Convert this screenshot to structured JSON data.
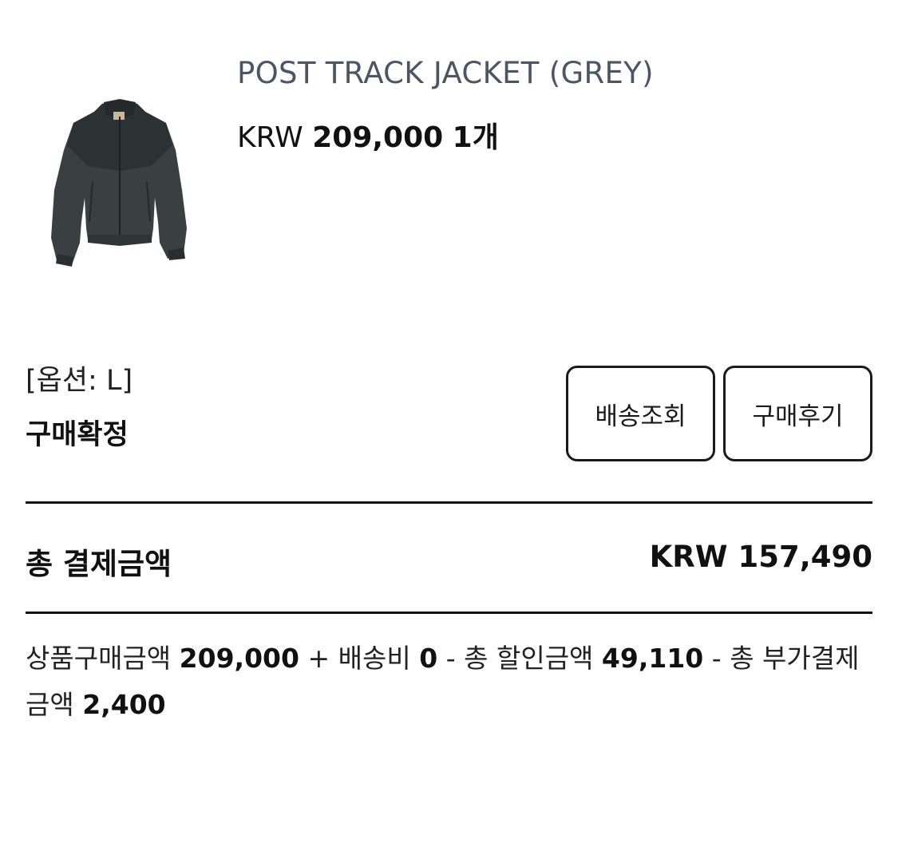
{
  "product": {
    "title": "POST TRACK JACKET (GREY)",
    "currency": "KRW",
    "price": "209,000",
    "quantity": "1개",
    "image_icon": "jacket-thumbnail"
  },
  "order": {
    "option": "[옵션: L]",
    "status": "구매확정"
  },
  "actions": {
    "shipping_label": "배송조회",
    "review_label": "구매후기"
  },
  "total": {
    "label": "총 결제금액",
    "value": "KRW 157,490"
  },
  "breakdown": {
    "product_amount_label": "상품구매금액",
    "product_amount": "209,000",
    "plus": "+",
    "shipping_label": "배송비",
    "shipping_amount": "0",
    "minus1": "-",
    "discount_label": "총 할인금액",
    "discount_amount": "49,110",
    "minus2": "-",
    "additional_label": "총 부가결제금액",
    "additional_amount": "2,400"
  },
  "colors": {
    "title_grey": "#4b5563",
    "text": "#111111",
    "jacket": "#3a4042"
  }
}
